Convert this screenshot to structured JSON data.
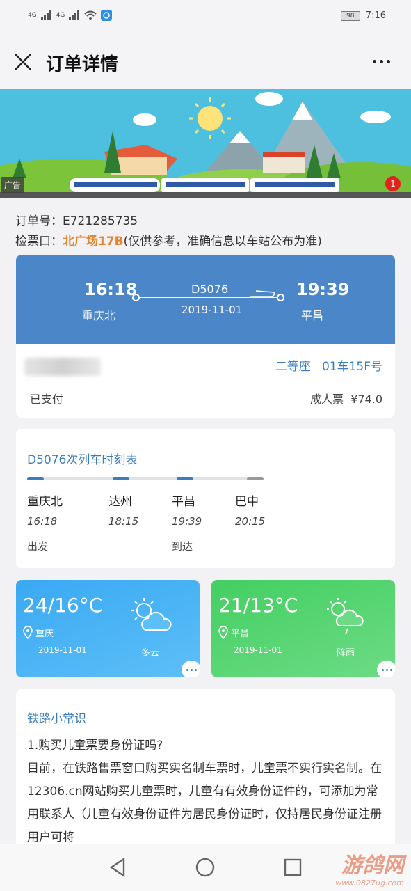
{
  "status": {
    "signal1": "4G",
    "signal2": "4G",
    "battery": "98",
    "time": "7:16"
  },
  "header": {
    "title": "订单详情"
  },
  "banner": {
    "ad_label": "广告",
    "badge_count": "1"
  },
  "order": {
    "number_label": "订单号：",
    "number": "E721285735",
    "gate_label": "检票口：",
    "gate": "北广场17B",
    "gate_note": "(仅供参考，准确信息以车站公布为准)"
  },
  "trip": {
    "depart_time": "16:18",
    "depart_station": "重庆北",
    "train": "D5076",
    "date": "2019-11-01",
    "arrive_time": "19:39",
    "arrive_station": "平昌",
    "seat_class": "二等座",
    "seat": "01车15F号",
    "pay_status": "已支付",
    "ticket_type": "成人票",
    "price": "¥74.0"
  },
  "schedule": {
    "title": "D5076次列车时刻表",
    "stops": [
      {
        "name": "重庆北",
        "time": "16:18",
        "status": "出发"
      },
      {
        "name": "达州",
        "time": "18:15",
        "status": ""
      },
      {
        "name": "平昌",
        "time": "19:39",
        "status": "到达"
      },
      {
        "name": "巴中",
        "time": "20:15",
        "status": ""
      }
    ]
  },
  "weather": [
    {
      "temp": "24/16°C",
      "city": "重庆",
      "date": "2019-11-01",
      "desc": "多云",
      "icon": "partly-cloudy-icon"
    },
    {
      "temp": "21/13°C",
      "city": "平昌",
      "date": "2019-11-01",
      "desc": "阵雨",
      "icon": "shower-icon"
    }
  ],
  "tips": {
    "title": "铁路小常识",
    "question": "1.购买儿童票要身份证吗?",
    "body": "目前，在铁路售票窗口购买实名制车票时，儿童票不实行实名制。在12306.cn网站购买儿童票时，儿童有有效身份证件的，可添加为常用联系人（儿童有效身份证件为居民身份证时，仅持居民身份证注册用户可将"
  },
  "watermark": {
    "title": "游鸽网",
    "url": "www.0827ug.com"
  },
  "colors": {
    "accent": "#3a7dbf",
    "trip_header": "#4a86c8",
    "gate_highlight": "#e8832b"
  }
}
